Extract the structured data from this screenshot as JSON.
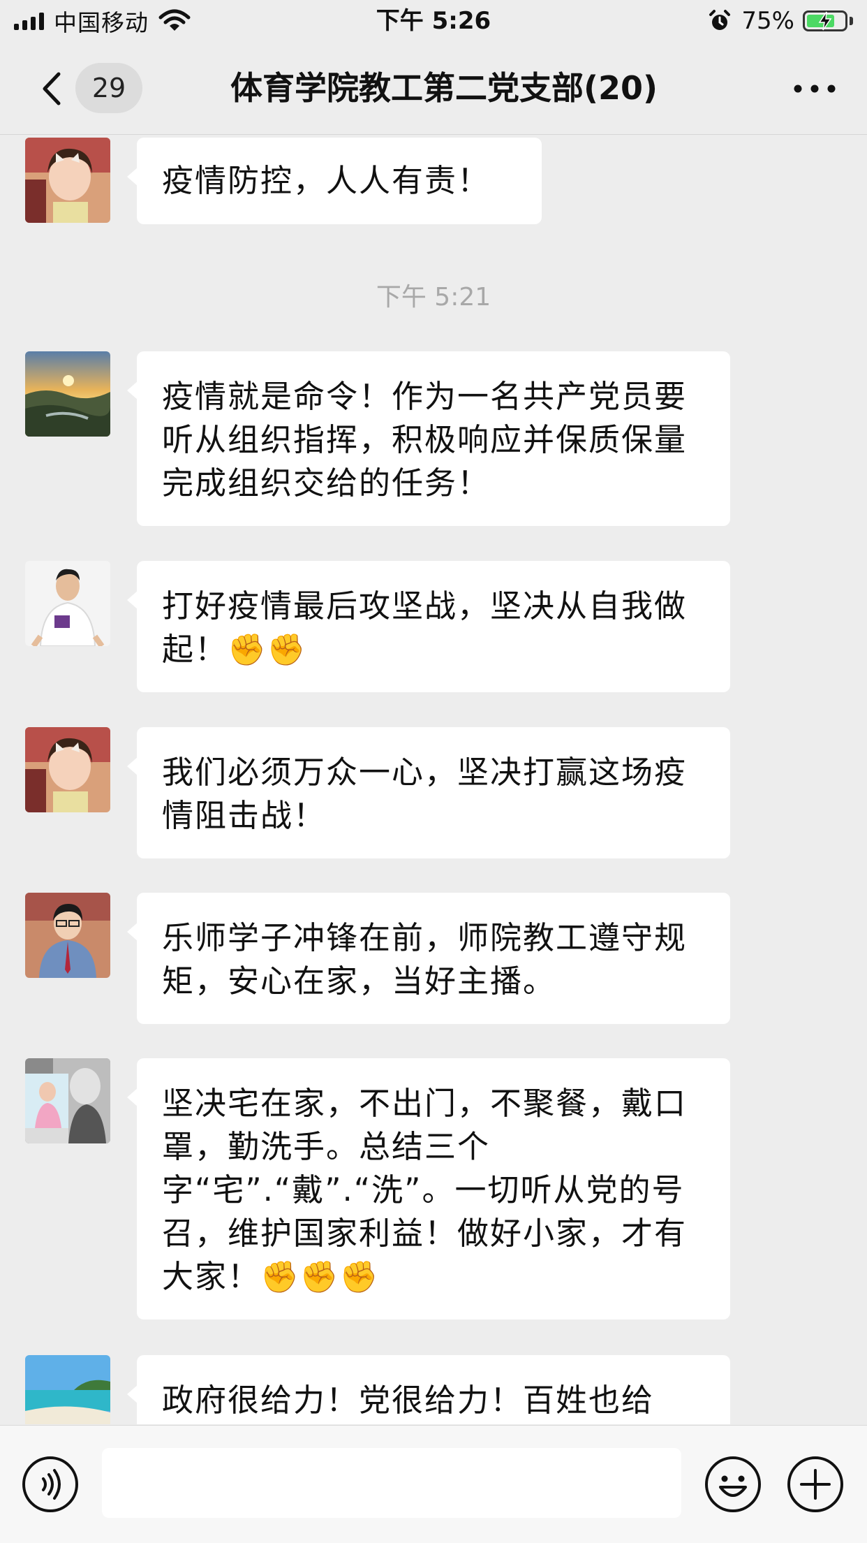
{
  "status_bar": {
    "carrier": "中国移动",
    "time": "下午 5:26",
    "battery_percent": "75%",
    "battery_level": 0.75,
    "icons": [
      "signal-icon",
      "wifi-icon",
      "alarm-icon",
      "battery-charging-icon"
    ]
  },
  "nav": {
    "back_icon": "chevron-left-icon",
    "unread_count": "29",
    "title": "体育学院教工第二党支部(20)",
    "more_icon": "more-dots-icon"
  },
  "messages": [
    {
      "avatar": "avatar-girl",
      "text": "疫情防控，人人有责！"
    },
    {
      "timestamp": "下午 5:21"
    },
    {
      "avatar": "avatar-sunset",
      "text": "疫情就是命令！作为一名共产党员要听从组织指挥，积极响应并保质保量完成组织交给的任务！"
    },
    {
      "avatar": "avatar-man",
      "text": "打好疫情最后攻坚战，坚决从自我做起！",
      "emoji": "✊✊"
    },
    {
      "avatar": "avatar-girl",
      "text": "我们必须万众一心，坚决打赢这场疫情阻击战！"
    },
    {
      "avatar": "avatar-boy",
      "text": "乐师学子冲锋在前，师院教工遵守规矩，安心在家，当好主播。"
    },
    {
      "avatar": "avatar-collage",
      "text": "坚决宅在家，不出门，不聚餐，戴口罩，勤洗手。总结三个字“宅”.“戴”.“洗”。一切听从党的号召，维护国家利益！做好小家，才有大家！",
      "emoji": "✊✊✊"
    },
    {
      "avatar": "avatar-beach",
      "text": "政府很给力！党很给力！百姓也给"
    }
  ],
  "input_bar": {
    "voice_icon": "voice-icon",
    "input_value": "",
    "emoji_icon": "emoji-icon",
    "plus_icon": "plus-icon"
  },
  "colors": {
    "background": "#ededed",
    "bubble": "#ffffff",
    "timestamp": "#a8a8a8",
    "battery": "#4cd964"
  }
}
